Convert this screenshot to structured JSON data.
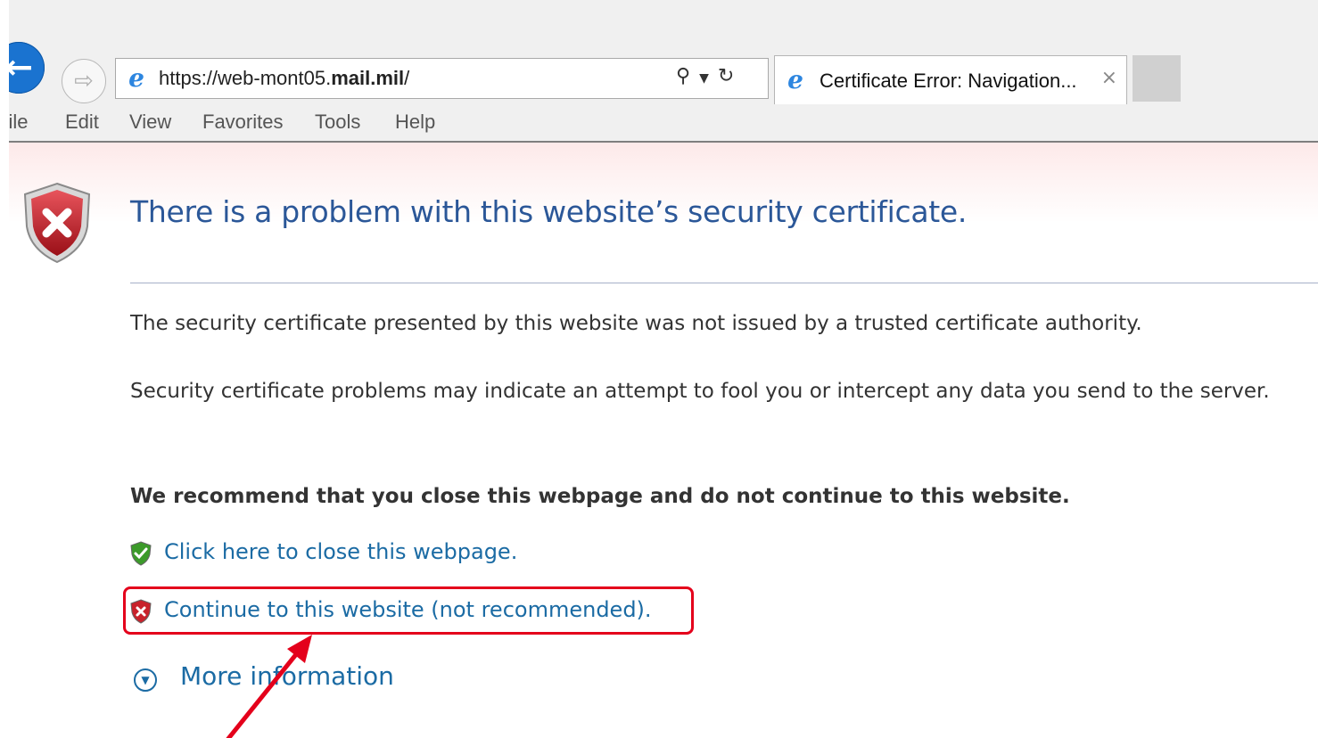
{
  "browser": {
    "url_prefix": "https://web-mont05.",
    "url_domain": "mail.mil",
    "url_suffix": "/",
    "tab_title": "Certificate Error: Navigation...",
    "tab_close": "×",
    "icons": [
      "back-arrow-icon",
      "forward-arrow-icon",
      "ie-logo-icon",
      "search-icon",
      "dropdown-icon",
      "refresh-icon",
      "close-icon"
    ]
  },
  "menu": {
    "file": "File",
    "edit": "Edit",
    "view": "View",
    "favorites": "Favorites",
    "tools": "Tools",
    "help": "Help"
  },
  "page": {
    "heading": "There is a problem with this website’s security certificate.",
    "p1": "The security certificate presented by this website was not issued by a trusted certificate authority.",
    "p2": "Security certificate problems may indicate an attempt to fool you or intercept any data you send to the server.",
    "recommend": "We recommend that you close this webpage and do not continue to this website.",
    "close_link": "Click here to close this webpage.",
    "continue_link": "Continue to this website (not recommended).",
    "more_info": "More information"
  },
  "colors": {
    "heading": "#2b5798",
    "link": "#1b6ba4",
    "annotation": "#e4001b",
    "shield_red": "#c8222b",
    "shield_green": "#3c9a2a"
  }
}
